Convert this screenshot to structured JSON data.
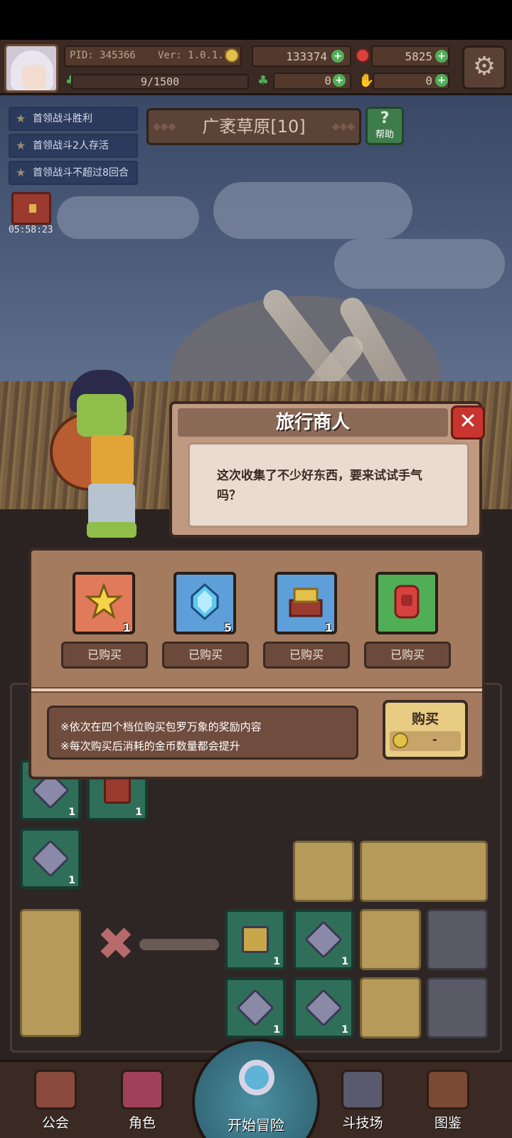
{
  "header": {
    "pid": "PID: 345366",
    "version": "Ver: 1.0.1.1",
    "gold": "133374",
    "gems": "5825",
    "xp": "9/1500",
    "clover": "0",
    "hand": "0"
  },
  "quests": [
    "首领战斗胜利",
    "首领战斗2人存活",
    "首领战斗不超过8回合"
  ],
  "chest_timer": "05:58:23",
  "location": "广袤草原[10]",
  "help_label": "帮助",
  "help_glyph": "?",
  "dialog": {
    "title": "旅行商人",
    "close_glyph": "✕",
    "message": "这次收集了不少好东西，要来试试手气吗？"
  },
  "shop": {
    "items": [
      {
        "name": "star-icon",
        "count": "1",
        "status": "已购买",
        "bg": "#e07a5a"
      },
      {
        "name": "crystal-icon",
        "count": "5",
        "status": "已购买",
        "bg": "#5f9fd9"
      },
      {
        "name": "gold-chest-icon",
        "count": "1",
        "status": "已购买",
        "bg": "#5f9fd9"
      },
      {
        "name": "red-gem-icon",
        "count": "",
        "status": "已购买",
        "bg": "#4fae56"
      }
    ],
    "info_line1": "※依次在四个档位购买包罗万象的奖励内容",
    "info_line2": "※每次购买后消耗的金币数量都会提升",
    "buy_label": "购买",
    "buy_price": "-"
  },
  "inventory_counts": [
    "1",
    "1",
    "1",
    "1",
    "1",
    "1",
    "1"
  ],
  "nav": {
    "guild": "公会",
    "role": "角色",
    "adventure": "开始冒险",
    "arena": "斗技场",
    "codex": "图鉴"
  },
  "colors": {
    "accent_gold": "#e2c14a",
    "panel_brown": "#a47b5f",
    "close_red": "#c8352f"
  }
}
